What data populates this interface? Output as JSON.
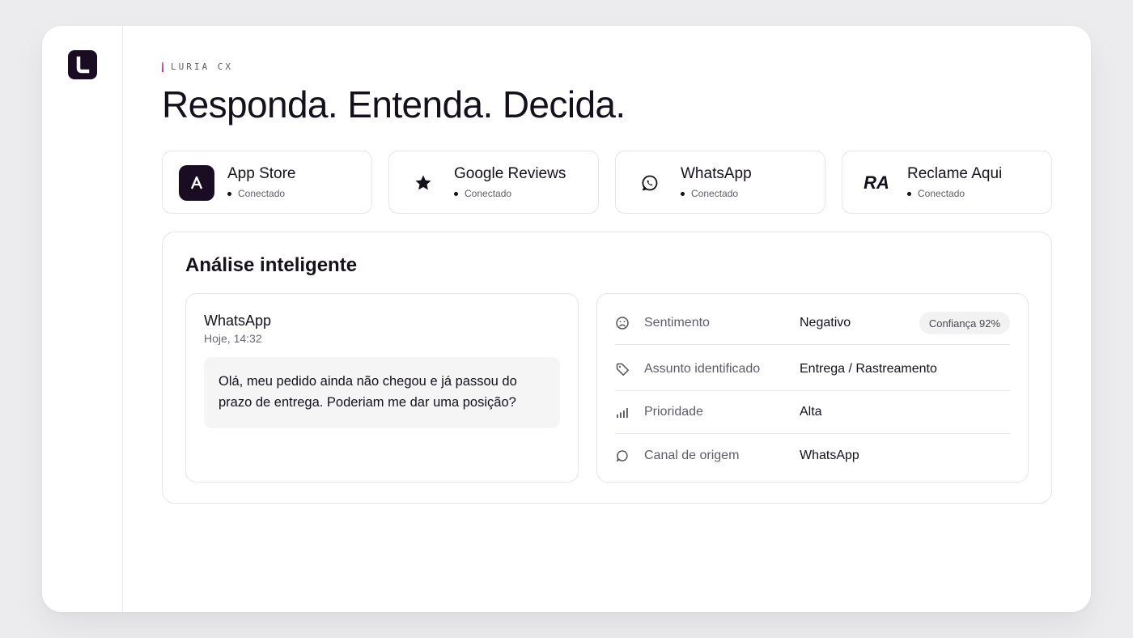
{
  "brand": {
    "eyebrow": "LURIA CX",
    "logo_icon": "luria-logo-icon"
  },
  "hero": {
    "headline": "Responda. Entenda. Decida."
  },
  "channels": [
    {
      "name": "App Store",
      "status": "Conectado",
      "icon": "app-store-icon"
    },
    {
      "name": "Google Reviews",
      "status": "Conectado",
      "icon": "star-icon"
    },
    {
      "name": "WhatsApp",
      "status": "Conectado",
      "icon": "whatsapp-icon"
    },
    {
      "name": "Reclame Aqui",
      "status": "Conectado",
      "icon": "RA"
    }
  ],
  "analysis": {
    "title": "Análise inteligente",
    "message": {
      "source": "WhatsApp",
      "time": "Hoje, 14:32",
      "text": "Olá, meu pedido ainda não chegou e já passou do prazo de entrega. Poderiam me dar uma posição?"
    },
    "details": [
      {
        "icon": "sad-face-icon",
        "label": "Sentimento",
        "value": "Negativo",
        "badge": "Confiança 92%"
      },
      {
        "icon": "tag-icon",
        "label": "Assunto identificado",
        "value": "Entrega / Rastreamento"
      },
      {
        "icon": "signal-bars-icon",
        "label": "Prioridade",
        "value": "Alta"
      },
      {
        "icon": "chat-bubble-icon",
        "label": "Canal de origem",
        "value": "WhatsApp"
      }
    ]
  },
  "colors": {
    "brand_dark": "#1a0d23",
    "background": "#ececee",
    "border": "#e5e4e8"
  }
}
